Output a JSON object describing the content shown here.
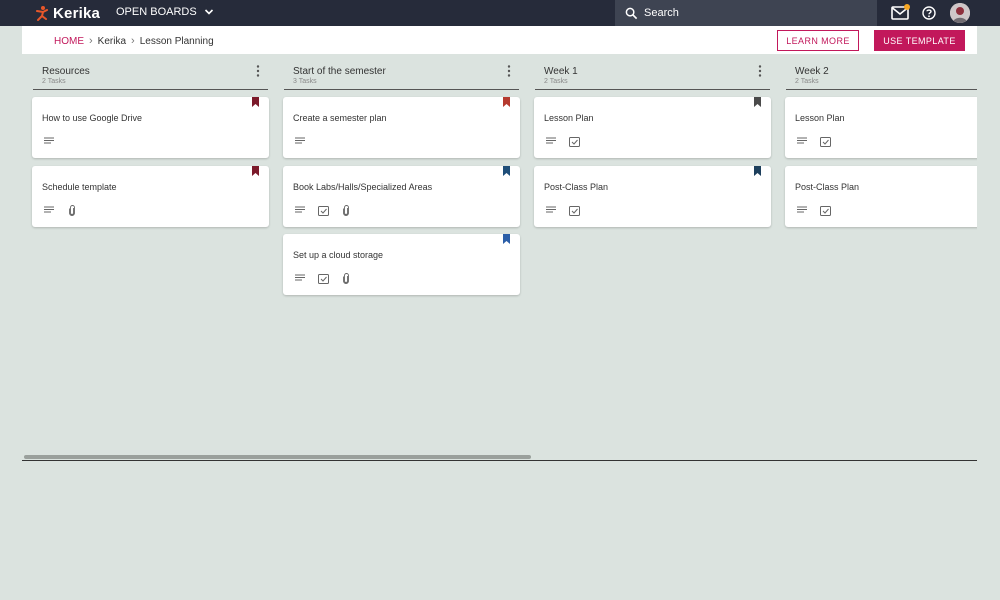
{
  "app": {
    "name": "Kerika"
  },
  "topbar": {
    "open_boards_label": "OPEN BOARDS",
    "search_label": "Search",
    "notification_color": "#f5a623"
  },
  "breadcrumb": {
    "home": "HOME",
    "items": [
      "Kerika",
      "Lesson Planning"
    ]
  },
  "actions": {
    "learn_more": "LEARN MORE",
    "use_template": "USE TEMPLATE",
    "accent_color": "#c2185b"
  },
  "columns": [
    {
      "title": "Resources",
      "count": "2 Tasks",
      "cards": [
        {
          "title": "How to use Google Drive",
          "flag_color": "#7b1a2a",
          "icons": [
            "description-icon"
          ]
        },
        {
          "title": "Schedule template",
          "flag_color": "#7b1a2a",
          "icons": [
            "description-icon",
            "attachment-icon"
          ]
        }
      ]
    },
    {
      "title": "Start of the semester",
      "count": "3 Tasks",
      "cards": [
        {
          "title": "Create a semester plan",
          "flag_color": "#b53a2f",
          "icons": [
            "description-icon"
          ]
        },
        {
          "title": "Book Labs/Halls/Specialized Areas",
          "flag_color": "#1f4e79",
          "icons": [
            "description-icon",
            "checklist-icon",
            "attachment-icon"
          ]
        },
        {
          "title": "Set up a cloud storage",
          "flag_color": "#2b5ea8",
          "icons": [
            "description-icon",
            "checklist-icon",
            "attachment-icon"
          ]
        }
      ]
    },
    {
      "title": "Week 1",
      "count": "2 Tasks",
      "cards": [
        {
          "title": "Lesson Plan",
          "flag_color": "#4a4a4a",
          "icons": [
            "description-icon",
            "checklist-icon"
          ]
        },
        {
          "title": "Post-Class Plan",
          "flag_color": "#1d3f5c",
          "icons": [
            "description-icon",
            "checklist-icon"
          ]
        }
      ]
    },
    {
      "title": "Week 2",
      "count": "2 Tasks",
      "cards": [
        {
          "title": "Lesson Plan",
          "flag_color": null,
          "icons": [
            "description-icon",
            "checklist-icon"
          ]
        },
        {
          "title": "Post-Class Plan",
          "flag_color": null,
          "icons": [
            "description-icon",
            "checklist-icon"
          ]
        }
      ]
    }
  ]
}
